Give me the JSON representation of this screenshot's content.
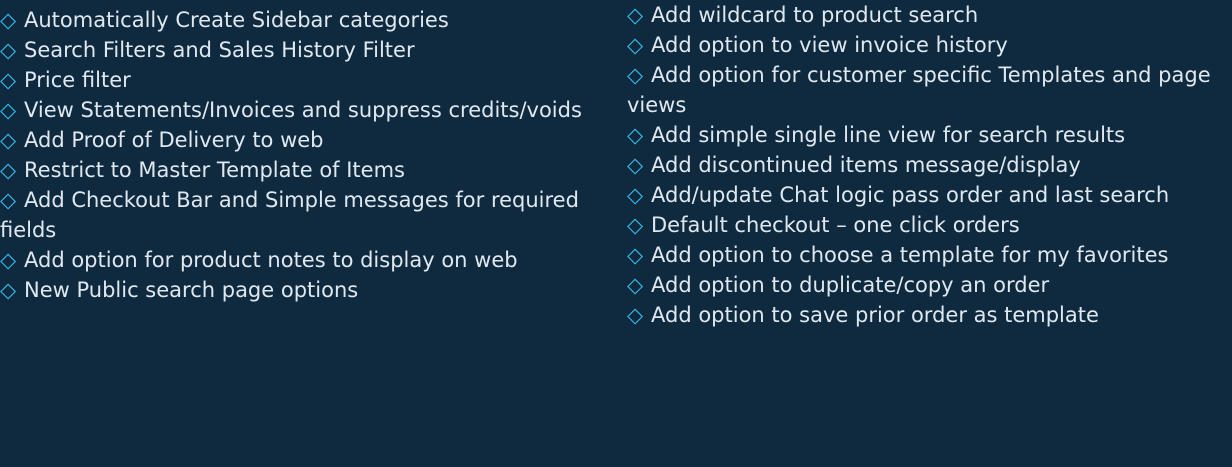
{
  "left_list": [
    {
      "icon": "diamond-bullet-icon",
      "text": "Automatically Create Sidebar categories"
    },
    {
      "icon": "diamond-bullet-icon",
      "text": "Search Filters and Sales History Filter"
    },
    {
      "icon": "diamond-bullet-icon",
      "text": "Price filter"
    },
    {
      "icon": "diamond-bullet-icon",
      "text": "View Statements/Invoices and suppress credits/voids"
    },
    {
      "icon": "diamond-bullet-icon",
      "text": "Add Proof of Delivery to web"
    },
    {
      "icon": "diamond-bullet-icon",
      "text": "Restrict to Master Template of Items"
    },
    {
      "icon": "diamond-bullet-icon",
      "text": "Add Checkout Bar and Simple messages for required fields"
    },
    {
      "icon": "diamond-bullet-icon",
      "text": "Add option for product notes to display on web"
    },
    {
      "icon": "diamond-bullet-icon",
      "text": "New Public search page options"
    }
  ],
  "right_list": [
    {
      "icon": "diamond-bullet-icon",
      "text": "Add wildcard to product search"
    },
    {
      "icon": "diamond-bullet-icon",
      "text": "Add option to view invoice history"
    },
    {
      "icon": "diamond-bullet-icon",
      "text": "Add option for customer specific Templates and page views"
    },
    {
      "icon": "diamond-bullet-icon",
      "text": "Add simple single line view for search results"
    },
    {
      "icon": "diamond-bullet-icon",
      "text": "Add discontinued items message/display"
    },
    {
      "icon": "diamond-bullet-icon",
      "text": "Add/update Chat logic pass order and last search"
    },
    {
      "icon": "diamond-bullet-icon",
      "text": "Default checkout – one click orders"
    },
    {
      "icon": "diamond-bullet-icon",
      "text": "Add option to choose a template for my favorites"
    },
    {
      "icon": "diamond-bullet-icon",
      "text": "Add option to duplicate/copy an order"
    },
    {
      "icon": "diamond-bullet-icon",
      "text": "Add option to save prior order as template"
    }
  ],
  "colors": {
    "background": "#0f2a3e",
    "text": "#dfe8f0",
    "bullet": "#36b9e6"
  }
}
